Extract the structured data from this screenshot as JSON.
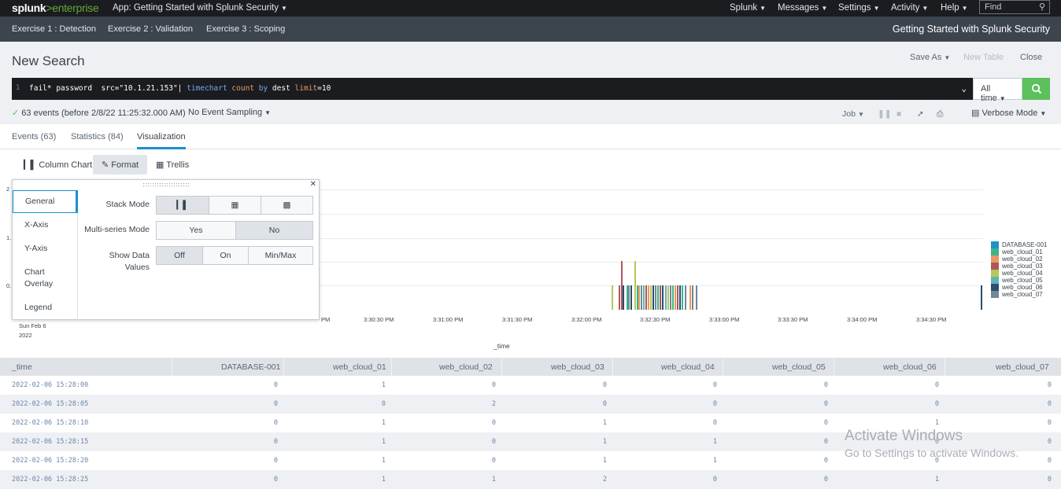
{
  "topbar": {
    "logo_a": "splunk",
    "logo_gt": ">",
    "logo_b": "enterprise",
    "app": "App: Getting Started with Splunk Security",
    "menus": [
      "Splunk",
      "Messages",
      "Settings",
      "Activity",
      "Help"
    ],
    "find_placeholder": "Find"
  },
  "appbar": {
    "nav": [
      "Exercise 1 : Detection",
      "Exercise 2 : Validation",
      "Exercise 3 : Scoping"
    ],
    "title": "Getting Started with Splunk Security"
  },
  "header": {
    "title": "New Search",
    "save_as": "Save As",
    "new_table": "New Table",
    "close": "Close"
  },
  "search": {
    "line_no": "1",
    "q1": "fail* password  src=\"10.1.21.153\"| ",
    "q2": "timechart",
    "q3": " ",
    "q4": "count",
    "q5": " by ",
    "q6": "dest",
    "q7": " ",
    "q8": "limit",
    "q9": "=10",
    "time_range": "All time"
  },
  "status": {
    "events": "63 events (before 2/8/22 11:25:32.000 AM)",
    "sampling": "No Event Sampling",
    "job": "Job",
    "mode": "Verbose Mode"
  },
  "tabs": [
    "Events (63)",
    "Statistics (84)",
    "Visualization"
  ],
  "vizbar": {
    "chart_type": "Column Chart",
    "format": "Format",
    "trellis": "Trellis"
  },
  "format_panel": {
    "sections": [
      "General",
      "X-Axis",
      "Y-Axis",
      "Chart Overlay",
      "Legend"
    ],
    "stack_mode_label": "Stack Mode",
    "multi_series_label": "Multi-series Mode",
    "multi_series_options": [
      "Yes",
      "No"
    ],
    "show_values_label": "Show Data Values",
    "show_values_options": [
      "Off",
      "On",
      "Min/Max"
    ]
  },
  "chart_data": {
    "type": "bar",
    "xlabel": "_time",
    "x_ticks": [
      "Sun Feb 6",
      "2022",
      "PM",
      "3:30:30 PM",
      "3:31:00 PM",
      "3:31:30 PM",
      "3:32:00 PM",
      "3:32:30 PM",
      "3:33:00 PM",
      "3:33:30 PM",
      "3:34:00 PM",
      "3:34:30 PM"
    ],
    "y_ticks": [
      "2",
      "1.",
      "0."
    ],
    "series": [
      {
        "name": "DATABASE-001",
        "color": "#1e93c6"
      },
      {
        "name": "web_cloud_01",
        "color": "#3cb48c"
      },
      {
        "name": "web_cloud_02",
        "color": "#ec9960"
      },
      {
        "name": "web_cloud_03",
        "color": "#af575a"
      },
      {
        "name": "web_cloud_04",
        "color": "#b6c75a"
      },
      {
        "name": "web_cloud_05",
        "color": "#62b3b2"
      },
      {
        "name": "web_cloud_06",
        "color": "#294e70"
      },
      {
        "name": "web_cloud_07",
        "color": "#738795"
      }
    ]
  },
  "table": {
    "headers": [
      "_time",
      "DATABASE-001",
      "web_cloud_01",
      "web_cloud_02",
      "web_cloud_03",
      "web_cloud_04",
      "web_cloud_05",
      "web_cloud_06",
      "web_cloud_07"
    ],
    "rows": [
      [
        "2022-02-06 15:28:00",
        "0",
        "1",
        "0",
        "0",
        "0",
        "0",
        "0",
        "0"
      ],
      [
        "2022-02-06 15:28:05",
        "0",
        "0",
        "2",
        "0",
        "0",
        "0",
        "0",
        "0"
      ],
      [
        "2022-02-06 15:28:10",
        "0",
        "1",
        "0",
        "1",
        "0",
        "0",
        "1",
        "0"
      ],
      [
        "2022-02-06 15:28:15",
        "0",
        "1",
        "0",
        "1",
        "1",
        "0",
        "0",
        "0"
      ],
      [
        "2022-02-06 15:28:20",
        "0",
        "1",
        "0",
        "1",
        "1",
        "0",
        "0",
        "0"
      ],
      [
        "2022-02-06 15:28:25",
        "0",
        "1",
        "1",
        "2",
        "0",
        "0",
        "1",
        "0"
      ]
    ]
  },
  "watermark": {
    "title": "Activate Windows",
    "sub": "Go to Settings to activate Windows."
  }
}
